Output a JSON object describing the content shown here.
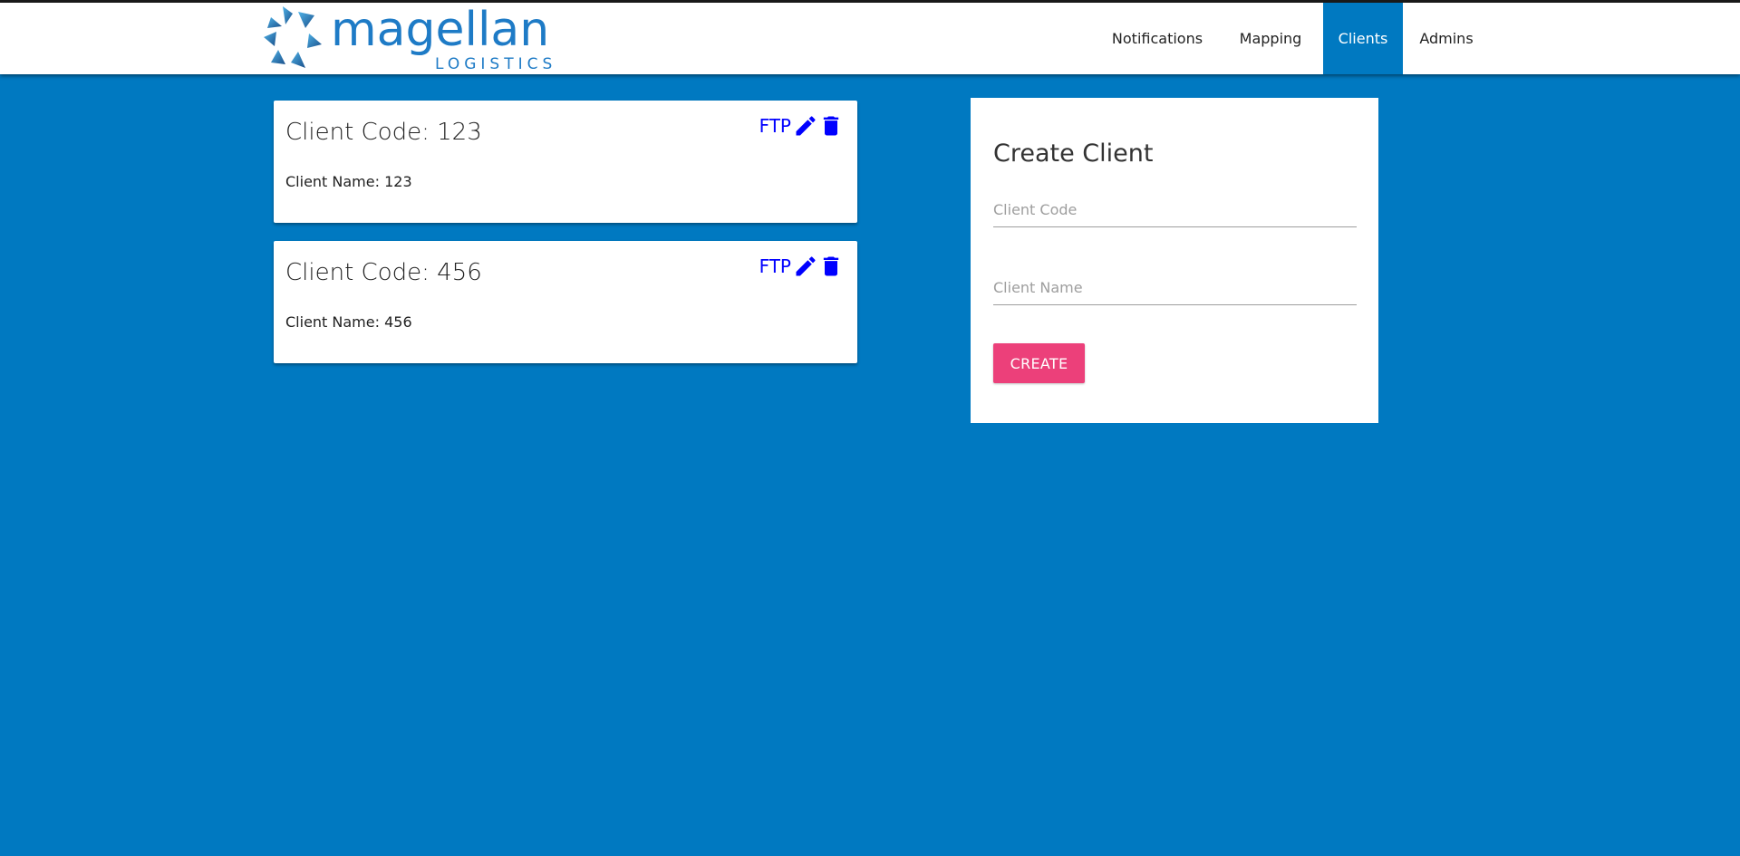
{
  "brand": {
    "name": "magellan",
    "sub": "LOGISTICS",
    "colors": {
      "primary": "#1e7bc6",
      "dark": "#1a4f8a",
      "light": "#4fb3e8"
    }
  },
  "nav": {
    "items": [
      {
        "label": "Notifications",
        "active": false
      },
      {
        "label": "Mapping",
        "active": false
      },
      {
        "label": "Clients",
        "active": true
      },
      {
        "label": "Admins",
        "active": false
      }
    ]
  },
  "clients": [
    {
      "title": "Client Code: 123",
      "name": "Client Name: 123",
      "ftp_label": "FTP",
      "edit_icon": "pencil-icon",
      "delete_icon": "trash-icon"
    },
    {
      "title": "Client Code: 456",
      "name": "Client Name: 456",
      "ftp_label": "FTP",
      "edit_icon": "pencil-icon",
      "delete_icon": "trash-icon"
    }
  ],
  "create_panel": {
    "title": "Create Client",
    "code_placeholder": "Client Code",
    "code_value": "",
    "name_placeholder": "Client Name",
    "name_value": "",
    "button_label": "CREATE"
  },
  "colors": {
    "background": "#0079c1",
    "nav_active": "#0079c1",
    "action": "#0000ff",
    "button": "#ec407a"
  }
}
